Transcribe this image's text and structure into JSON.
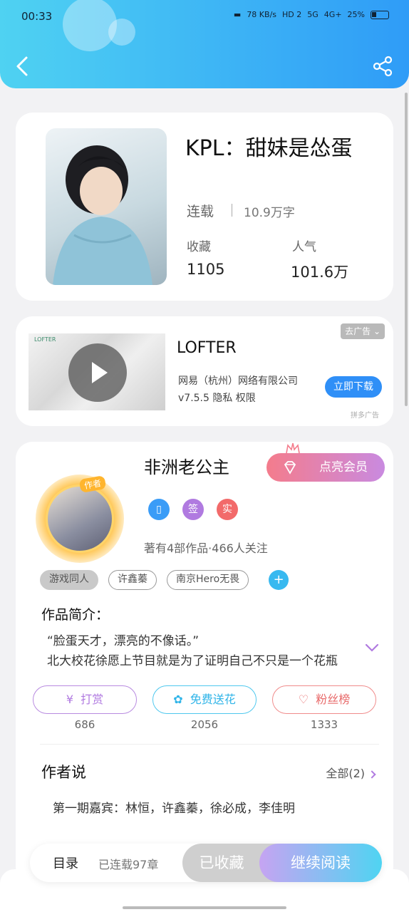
{
  "status_bar": {
    "time": "00:33",
    "indicators": [
      "78 KB/s",
      "HD 2",
      "5G",
      "4G+"
    ],
    "battery": "25%"
  },
  "header": {
    "back_icon": "chevron-left-icon",
    "share_icon": "share-icon"
  },
  "book": {
    "title": "KPL：甜妹是怂蛋",
    "status": "连载",
    "word_count": "10.9万字",
    "favorites_label": "收藏",
    "favorites_value": "1105",
    "popularity_label": "人气",
    "popularity_value": "101.6万"
  },
  "ad": {
    "title": "LOFTER",
    "company": "网易（杭州）网络有限公司",
    "version_line": "v7.5.5 隐私 权限",
    "close_label": "去广告",
    "download_label": "立即下载",
    "ad_tag": "拼多广告",
    "video_logo": "LOFTER"
  },
  "author": {
    "name": "非洲老公主",
    "avatar_tag": "作者",
    "vip_button": "点亮会员",
    "badges": [
      {
        "label": "",
        "color": "#3a9cf7"
      },
      {
        "label": "签",
        "color": "#b07ae0"
      },
      {
        "label": "实",
        "color": "#f26a6a"
      }
    ],
    "info": "著有4部作品·466人关注",
    "tags": [
      "游戏同人",
      "许鑫蓁",
      "南京Hero无畏"
    ],
    "tag_add": "+",
    "intro_label": "作品简介：",
    "intro_lines": [
      "“脸蛋天才，漂亮的不像话。”",
      "北大校花徐愿上节目就是为了证明自己不只是一个花瓶"
    ],
    "actions": [
      {
        "label": "打赏",
        "count": "686"
      },
      {
        "label": "免费送花",
        "count": "2056"
      },
      {
        "label": "粉丝榜",
        "count": "1333"
      }
    ],
    "words_title": "作者说",
    "words_all": "全部(2)",
    "words_preview": "第一期嘉宾：林恒，许鑫蓁，徐必成，李佳明"
  },
  "bottom_bar": {
    "toc_label": "目录",
    "toc_status": "已连载97章",
    "collected_label": "已收藏",
    "continue_label": "继续阅读"
  }
}
